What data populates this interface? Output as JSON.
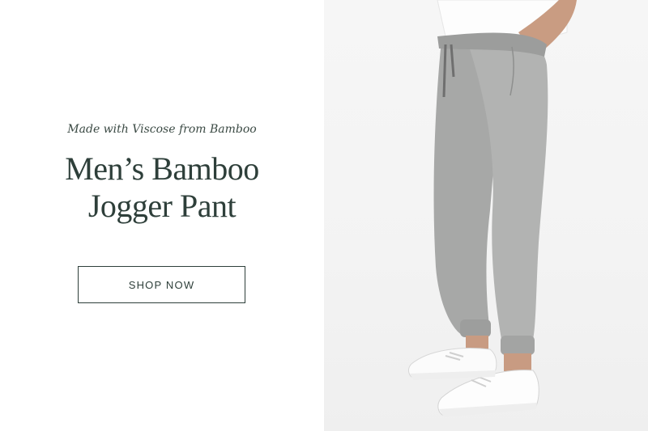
{
  "hero": {
    "eyebrow": "Made with Viscose from Bamboo",
    "headline_line1": "Men’s Bamboo",
    "headline_line2": "Jogger Pant",
    "cta_label": "SHOP NOW"
  },
  "colors": {
    "text_primary": "#2e3f3a",
    "pants_gray": "#a9aaa9",
    "shoe_white": "#fbfbfb",
    "background_right": "#f4f4f4"
  }
}
